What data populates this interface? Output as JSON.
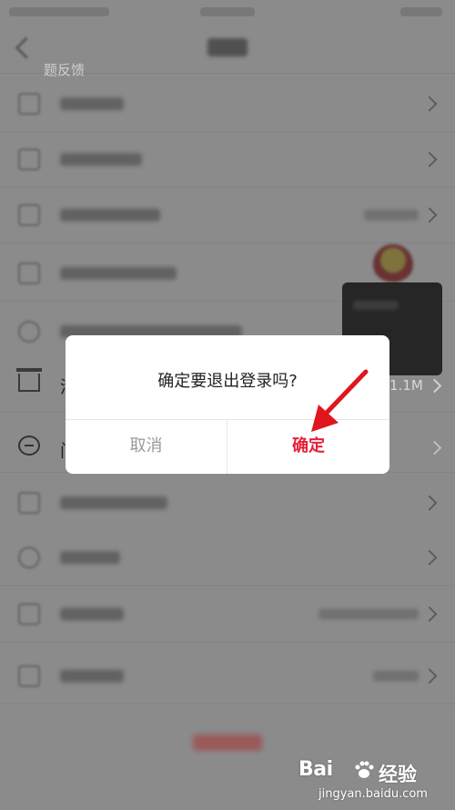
{
  "background": {
    "cache_row": {
      "label_visible": "清",
      "size": "1.1M"
    },
    "feedback_row": {
      "label_visible": "问"
    },
    "tooltip": {
      "text": "题反馈"
    }
  },
  "dialog": {
    "message": "确定要退出登录吗?",
    "cancel_label": "取消",
    "confirm_label": "确定",
    "confirm_color": "#e5203a"
  },
  "annotation": {
    "arrow_color": "#e0161f"
  },
  "watermark": {
    "brand": "Bai",
    "brand_suffix": "经验",
    "url": "jingyan.baidu.com"
  }
}
